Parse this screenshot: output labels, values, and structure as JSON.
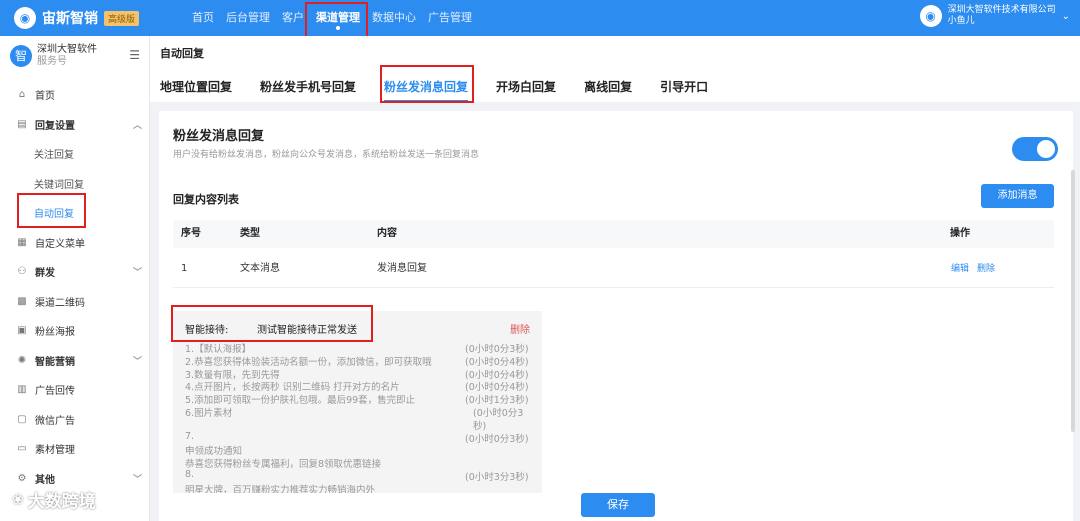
{
  "brand": {
    "name": "宙斯智销",
    "badge": "高级版",
    "logo_glyph": "◉"
  },
  "topnav": {
    "items": [
      "首页",
      "后台管理",
      "客户",
      "渠道管理",
      "数据中心",
      "广告管理"
    ],
    "active_index": 3
  },
  "company": {
    "name": "深圳大智软件技术有限公司",
    "user": "小鱼儿"
  },
  "account": {
    "name": "深圳大智软件",
    "type": "服务号",
    "avatar_glyph": "智"
  },
  "sidebar": {
    "items": [
      {
        "label": "首页",
        "icon": "home-icon",
        "glyph": "⌂"
      },
      {
        "label": "回复设置",
        "icon": "message-icon",
        "glyph": "▤",
        "expanded": true
      },
      {
        "label": "关注回复"
      },
      {
        "label": "关键词回复"
      },
      {
        "label": "自动回复",
        "active": true
      },
      {
        "label": "自定义菜单",
        "icon": "grid-icon",
        "glyph": "▦"
      },
      {
        "label": "群发",
        "icon": "users-icon",
        "glyph": "⚇"
      },
      {
        "label": "渠道二维码",
        "icon": "qrcode-icon",
        "glyph": "▩"
      },
      {
        "label": "粉丝海报",
        "icon": "poster-icon",
        "glyph": "▣"
      },
      {
        "label": "智能营销",
        "icon": "bulb-icon",
        "glyph": "✺"
      },
      {
        "label": "广告回传",
        "icon": "ad-icon",
        "glyph": "▥"
      },
      {
        "label": "微信广告",
        "icon": "wechat-ad-icon",
        "glyph": "▢"
      },
      {
        "label": "素材管理",
        "icon": "folder-icon",
        "glyph": "▭"
      },
      {
        "label": "其他",
        "icon": "gear-icon",
        "glyph": "⚙"
      }
    ]
  },
  "page": {
    "title": "自动回复"
  },
  "tabs": {
    "items": [
      "地理位置回复",
      "粉丝发手机号回复",
      "粉丝发消息回复",
      "开场白回复",
      "离线回复",
      "引导开口"
    ],
    "active_index": 2
  },
  "section": {
    "title": "粉丝发消息回复",
    "desc": "用户没有给粉丝发消息，粉丝向公众号发消息，系统给粉丝发送一条回复消息",
    "enabled": true
  },
  "list": {
    "title": "回复内容列表",
    "add_label": "添加消息",
    "columns": {
      "no": "序号",
      "type": "类型",
      "content": "内容",
      "op": "操作"
    },
    "rows": [
      {
        "no": "1",
        "type": "文本消息",
        "content": "发消息回复",
        "edit": "编辑",
        "delete": "删除"
      }
    ]
  },
  "smart": {
    "label": "智能接待:",
    "value": "测试智能接待正常发送",
    "delete_label": "删除",
    "lines": [
      {
        "text": "1.【默认海报】",
        "delay": "(0小时0分3秒)"
      },
      {
        "text": "2.恭喜您获得体验装活动名额一份，添加微信，即可获取哦",
        "delay": "(0小时0分4秒)"
      },
      {
        "text": "3.数量有限，先到先得",
        "delay": "(0小时0分4秒)"
      },
      {
        "text": "4.点开图片，长按两秒 识别二维码 打开对方的名片",
        "delay": "(0小时0分4秒)"
      },
      {
        "text": "5.添加即可领取一份护肤礼包哦。最后99套，售完即止",
        "delay": "(0小时1分3秒)"
      },
      {
        "text": "6.图片素材",
        "delay": "(0小时0分3",
        "indent": true
      },
      {
        "text": "",
        "delay": "秒)",
        "indent": true
      },
      {
        "text": "7.",
        "delay": "(0小时0分3秒)"
      },
      {
        "text": "   申领成功通知",
        "delay": ""
      },
      {
        "text": "   恭喜您获得粉丝专属福利，回复8领取优惠链接",
        "delay": ""
      },
      {
        "text": "8.",
        "delay": "(0小时3分3秒)"
      },
      {
        "text": "   明星大牌，百万赚粉实力推荐实力畅销海内外",
        "delay": ""
      }
    ]
  },
  "footer": {
    "save_label": "保存"
  },
  "watermark": {
    "text": "大数跨境",
    "glyph": "❀"
  },
  "colors": {
    "primary": "#2d8cf0",
    "highlight": "#e02020",
    "danger": "#e05555"
  }
}
